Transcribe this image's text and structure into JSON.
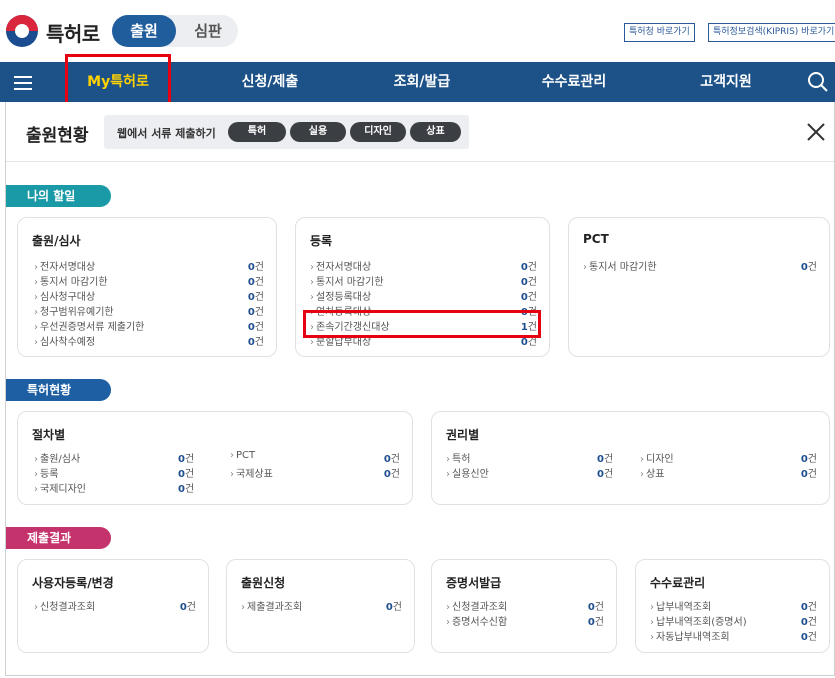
{
  "header": {
    "brand": "특허로",
    "mode_active": "출원",
    "mode_inactive": "심판",
    "links": [
      "특허청 바로가기",
      "특허정보검색(KIPRIS) 바로가기"
    ]
  },
  "nav": {
    "items": [
      "My특허로",
      "신청/제출",
      "조회/발급",
      "수수료관리",
      "고객지원"
    ]
  },
  "panel": {
    "title": "출원현황",
    "web_submit_label": "웹에서 서류 제출하기",
    "submit_buttons": [
      "특허",
      "실용",
      "디자인",
      "상표"
    ]
  },
  "unit": "건",
  "sections": {
    "todo": {
      "label": "나의 할일",
      "app_exam": {
        "title": "출원/심사",
        "rows": [
          {
            "label": "전자서명대상",
            "count": "0"
          },
          {
            "label": "통지서 마감기한",
            "count": "0"
          },
          {
            "label": "심사청구대상",
            "count": "0"
          },
          {
            "label": "청구범위유예기한",
            "count": "0"
          },
          {
            "label": "우선권증명서류 제출기한",
            "count": "0"
          },
          {
            "label": "심사착수예정",
            "count": "0"
          }
        ]
      },
      "registration": {
        "title": "등록",
        "rows": [
          {
            "label": "전자서명대상",
            "count": "0"
          },
          {
            "label": "통지서 마감기한",
            "count": "0"
          },
          {
            "label": "설정등록대상",
            "count": "0"
          },
          {
            "label": "연차등록대상",
            "count": "0"
          },
          {
            "label": "존속기간갱신대상",
            "count": "1"
          },
          {
            "label": "분할납부대상",
            "count": "0"
          }
        ]
      },
      "pct": {
        "title": "PCT",
        "rows": [
          {
            "label": "통지서 마감기한",
            "count": "0"
          }
        ]
      }
    },
    "status": {
      "label": "특허현황",
      "by_procedure": {
        "title": "절차별",
        "rows": [
          {
            "label": "출원/심사",
            "count": "0"
          },
          {
            "label": "등록",
            "count": "0"
          },
          {
            "label": "국제디자인",
            "count": "0"
          },
          {
            "label": "PCT",
            "count": "0"
          },
          {
            "label": "국제상표",
            "count": "0"
          }
        ]
      },
      "by_right": {
        "title": "권리별",
        "rows": [
          {
            "label": "특허",
            "count": "0"
          },
          {
            "label": "실용신안",
            "count": "0"
          },
          {
            "label": "디자인",
            "count": "0"
          },
          {
            "label": "상표",
            "count": "0"
          }
        ]
      }
    },
    "results": {
      "label": "제출결과",
      "user_reg": {
        "title": "사용자등록/변경",
        "rows": [
          {
            "label": "신청결과조회",
            "count": "0"
          }
        ]
      },
      "app_request": {
        "title": "출원신청",
        "rows": [
          {
            "label": "제출결과조회",
            "count": "0"
          }
        ]
      },
      "certificate": {
        "title": "증명서발급",
        "rows": [
          {
            "label": "신청결과조회",
            "count": "0"
          },
          {
            "label": "증명서수신함",
            "count": "0"
          }
        ]
      },
      "fee": {
        "title": "수수료관리",
        "rows": [
          {
            "label": "납부내역조회",
            "count": "0"
          },
          {
            "label": "납부내역조회(증명서)",
            "count": "0"
          },
          {
            "label": "자동납부내역조회",
            "count": "0"
          }
        ]
      }
    }
  },
  "colors": {
    "nav_bg": "#1d5289",
    "nav_active": "#ffd200",
    "tab_todo": "#1a9aa6",
    "tab_status": "#1e5fa3",
    "tab_results": "#c4336b",
    "highlight_box": "#e60012"
  }
}
